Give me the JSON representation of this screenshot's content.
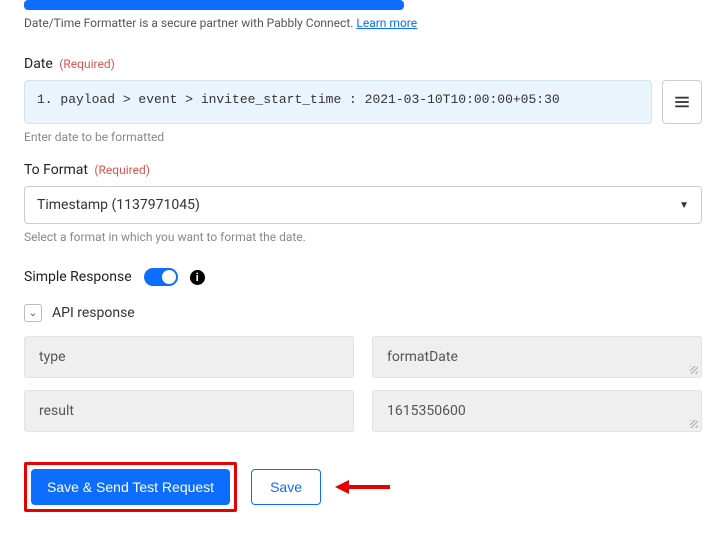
{
  "partner_text": "Date/Time Formatter is a secure partner with Pabbly Connect. ",
  "partner_link": "Learn more",
  "date": {
    "label": "Date",
    "required": "(Required)",
    "value": "1. payload > event > invitee_start_time : 2021-03-10T10:00:00+05:30",
    "helper": "Enter date to be formatted"
  },
  "to_format": {
    "label": "To Format",
    "required": "(Required)",
    "selected": "Timestamp (1137971045)",
    "helper": "Select a format in which you want to format the date."
  },
  "simple_response_label": "Simple Response",
  "info_glyph": "i",
  "api_response_label": "API response",
  "collapse_glyph": "⌄",
  "response_rows": [
    {
      "key": "type",
      "value": "formatDate"
    },
    {
      "key": "result",
      "value": "1615350600"
    }
  ],
  "buttons": {
    "primary": "Save & Send Test Request",
    "secondary": "Save"
  }
}
